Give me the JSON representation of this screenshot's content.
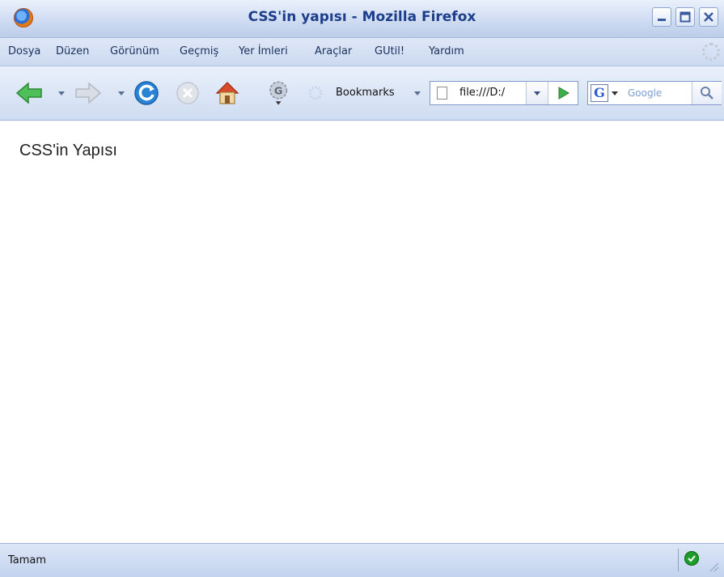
{
  "window": {
    "title": "CSS'in yapısı - Mozilla Firefox"
  },
  "menu": {
    "items": [
      "Dosya",
      "Düzen",
      "Görünüm",
      "Geçmiş",
      "Yer İmleri",
      "Araçlar",
      "GUtil!",
      "Yardım"
    ]
  },
  "toolbar": {
    "bookmarks_label": "Bookmarks",
    "url_value": "file:///D:/",
    "search_placeholder": "Google",
    "search_engine_letter": "G"
  },
  "page": {
    "heading": "CSS'in Yapısı"
  },
  "status": {
    "text": "Tamam"
  },
  "icons": {
    "back": "back-arrow-icon",
    "forward": "forward-arrow-icon",
    "reload": "reload-icon",
    "stop": "stop-icon",
    "home": "home-icon",
    "gtool": "google-toolbar-gear-icon"
  },
  "colors": {
    "titlebar": "#cfdcf2",
    "title_text": "#1d3e8a",
    "nav_green": "#3fae49",
    "reload_blue": "#2b83d6"
  }
}
